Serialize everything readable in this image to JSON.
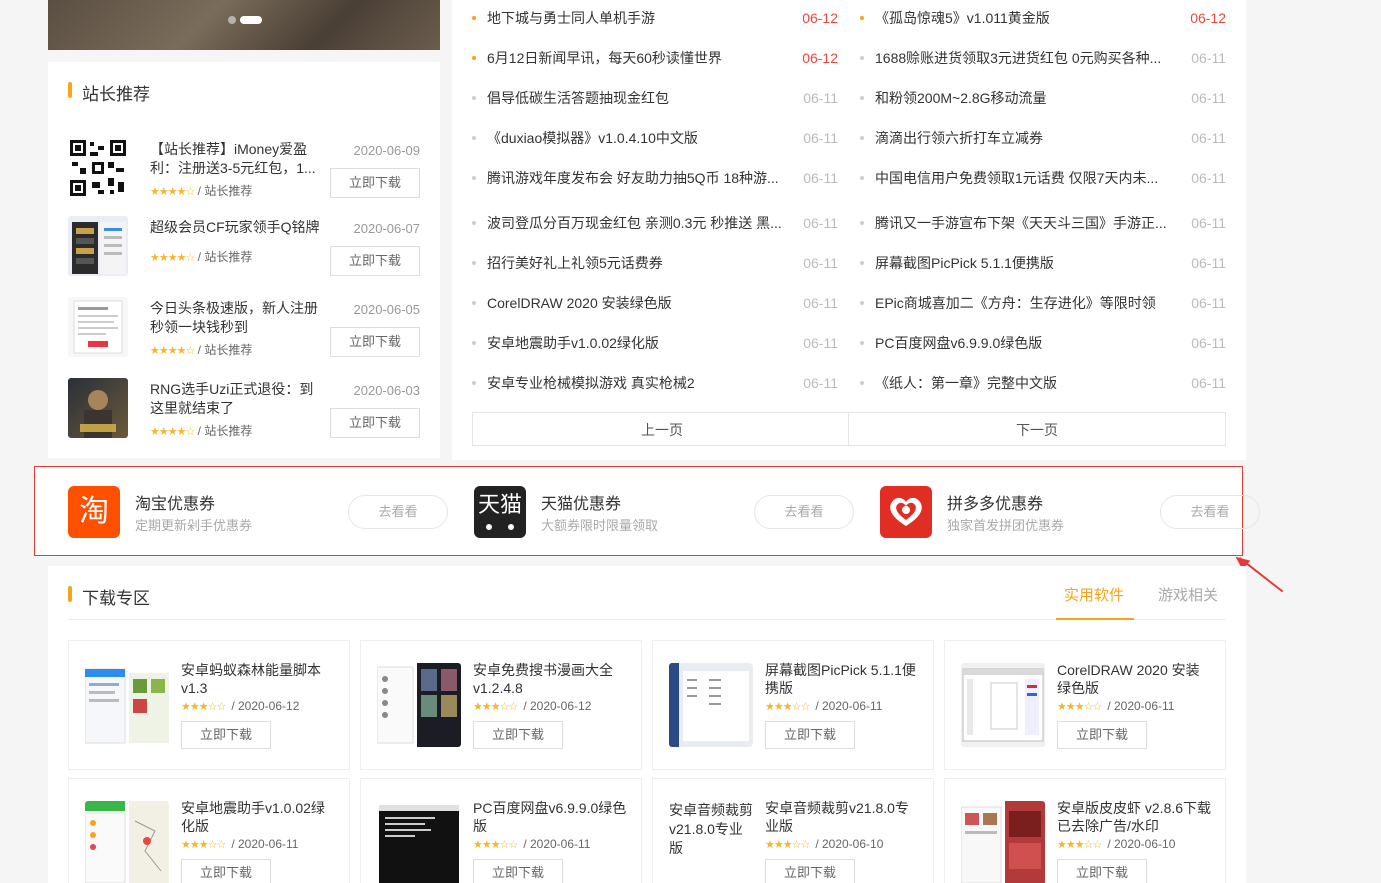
{
  "recommend": {
    "title": "站长推荐",
    "items": [
      {
        "title": "【站长推荐】iMoney爱盈利：注册送3-5元红包，1...",
        "date": "2020-06-09",
        "stars": "★★★★☆",
        "category": "/ 站长推荐",
        "button": "立即下载",
        "thumb": "qr-code-thumbnail"
      },
      {
        "title": "超级会员CF玩家领手Q铭牌",
        "date": "2020-06-07",
        "stars": "★★★★☆",
        "category": "/ 站长推荐",
        "button": "立即下载",
        "thumb": "phone-screenshot-thumbnail"
      },
      {
        "title": "今日头条极速版，新人注册秒领一块钱秒到",
        "date": "2020-06-05",
        "stars": "★★★★☆",
        "category": "/ 站长推荐",
        "button": "立即下载",
        "thumb": "phone-screenshot-thumbnail"
      },
      {
        "title": "RNG选手Uzi正式退役：到这里就结束了",
        "date": "2020-06-03",
        "stars": "★★★★☆",
        "category": "/ 站长推荐",
        "button": "立即下载",
        "thumb": "photo-thumbnail"
      }
    ]
  },
  "news": {
    "left": [
      {
        "text": "地下城与勇士同人单机手游",
        "date": "06-12",
        "hot": true
      },
      {
        "text": "6月12日新闻早讯，每天60秒读懂世界",
        "date": "06-12",
        "hot": true
      },
      {
        "text": "倡导低碳生活答题抽现金红包",
        "date": "06-11",
        "hot": false
      },
      {
        "text": "《duxiao模拟器》v1.0.4.10中文版",
        "date": "06-11",
        "hot": false
      },
      {
        "text": "腾讯游戏年度发布会 好友助力抽5Q币 18种游...",
        "date": "06-11",
        "hot": false
      },
      {
        "text": "波司登瓜分百万现金红包 亲测0.3元 秒推送 黑...",
        "date": "06-11",
        "hot": false
      },
      {
        "text": "招行美好礼上礼领5元话费券",
        "date": "06-11",
        "hot": false
      },
      {
        "text": "CorelDRAW 2020 安装绿色版",
        "date": "06-11",
        "hot": false
      },
      {
        "text": "安卓地震助手v1.0.02绿化版",
        "date": "06-11",
        "hot": false
      },
      {
        "text": "安卓专业枪械模拟游戏 真实枪械2",
        "date": "06-11",
        "hot": false
      }
    ],
    "right": [
      {
        "text": "《孤岛惊魂5》v1.011黄金版",
        "date": "06-12",
        "hot": true
      },
      {
        "text": "1688赊账进货领取3元进货红包 0元购买各种...",
        "date": "06-11",
        "hot": false
      },
      {
        "text": "和粉领200M~2.8G移动流量",
        "date": "06-11",
        "hot": false
      },
      {
        "text": "滴滴出行领六折打车立减券",
        "date": "06-11",
        "hot": false
      },
      {
        "text": "中国电信用户免费领取1元话费 仅限7天内未...",
        "date": "06-11",
        "hot": false
      },
      {
        "text": "腾讯又一手游宣布下架《天天斗三国》手游正...",
        "date": "06-11",
        "hot": false
      },
      {
        "text": "屏幕截图PicPick 5.1.1便携版",
        "date": "06-11",
        "hot": false
      },
      {
        "text": "EPic商城喜加二《方舟：生存进化》等限时领",
        "date": "06-11",
        "hot": false
      },
      {
        "text": "PC百度网盘v6.9.9.0绿色版",
        "date": "06-11",
        "hot": false
      },
      {
        "text": "《纸人：第一章》完整中文版",
        "date": "06-11",
        "hot": false
      }
    ],
    "prev": "上一页",
    "next": "下一页"
  },
  "coupons": [
    {
      "name": "淘宝优惠券",
      "desc": "定期更新剁手优惠券",
      "button": "去看看",
      "logo_char": "淘",
      "color": "#ff5000"
    },
    {
      "name": "天猫优惠券",
      "desc": "大额券限时限量领取",
      "button": "去看看",
      "logo_char": "天猫",
      "color": "#222222"
    },
    {
      "name": "拼多多优惠券",
      "desc": "独家首发拼团优惠券",
      "button": "去看看",
      "logo_char": "拼",
      "color": "#e02e24"
    }
  ],
  "downloads": {
    "title": "下载专区",
    "tabs": [
      "实用软件",
      "游戏相关"
    ],
    "items": [
      {
        "name": "安卓蚂蚁森林能量脚本v1.3",
        "stars": "★★★☆☆",
        "date": "/  2020-06-12",
        "button": "立即下载"
      },
      {
        "name": "安卓免费搜书漫画大全v1.2.4.8",
        "stars": "★★★☆☆",
        "date": "/  2020-06-12",
        "button": "立即下载"
      },
      {
        "name": "屏幕截图PicPick 5.1.1便携版",
        "stars": "★★★☆☆",
        "date": "/  2020-06-11",
        "button": "立即下载"
      },
      {
        "name": "CorelDRAW 2020 安装绿色版",
        "stars": "★★★☆☆",
        "date": "/  2020-06-11",
        "button": "立即下载"
      },
      {
        "name": "安卓地震助手v1.0.02绿化版",
        "stars": "★★★☆☆",
        "date": "/  2020-06-11",
        "button": "立即下载"
      },
      {
        "name": "PC百度网盘v6.9.9.0绿色版",
        "stars": "★★★☆☆",
        "date": "/  2020-06-11",
        "button": "立即下载"
      },
      {
        "name": "安卓音频裁剪v21.8.0专业版",
        "stars": "★★★☆☆",
        "date": "/  2020-06-10",
        "button": "立即下载",
        "alt": "安卓音频裁剪v21.8.0专业版"
      },
      {
        "name": "安卓版皮皮虾 v2.8.6下载 已去除广告/水印",
        "stars": "★★★☆☆",
        "date": "/  2020-06-10",
        "button": "立即下载"
      }
    ]
  }
}
